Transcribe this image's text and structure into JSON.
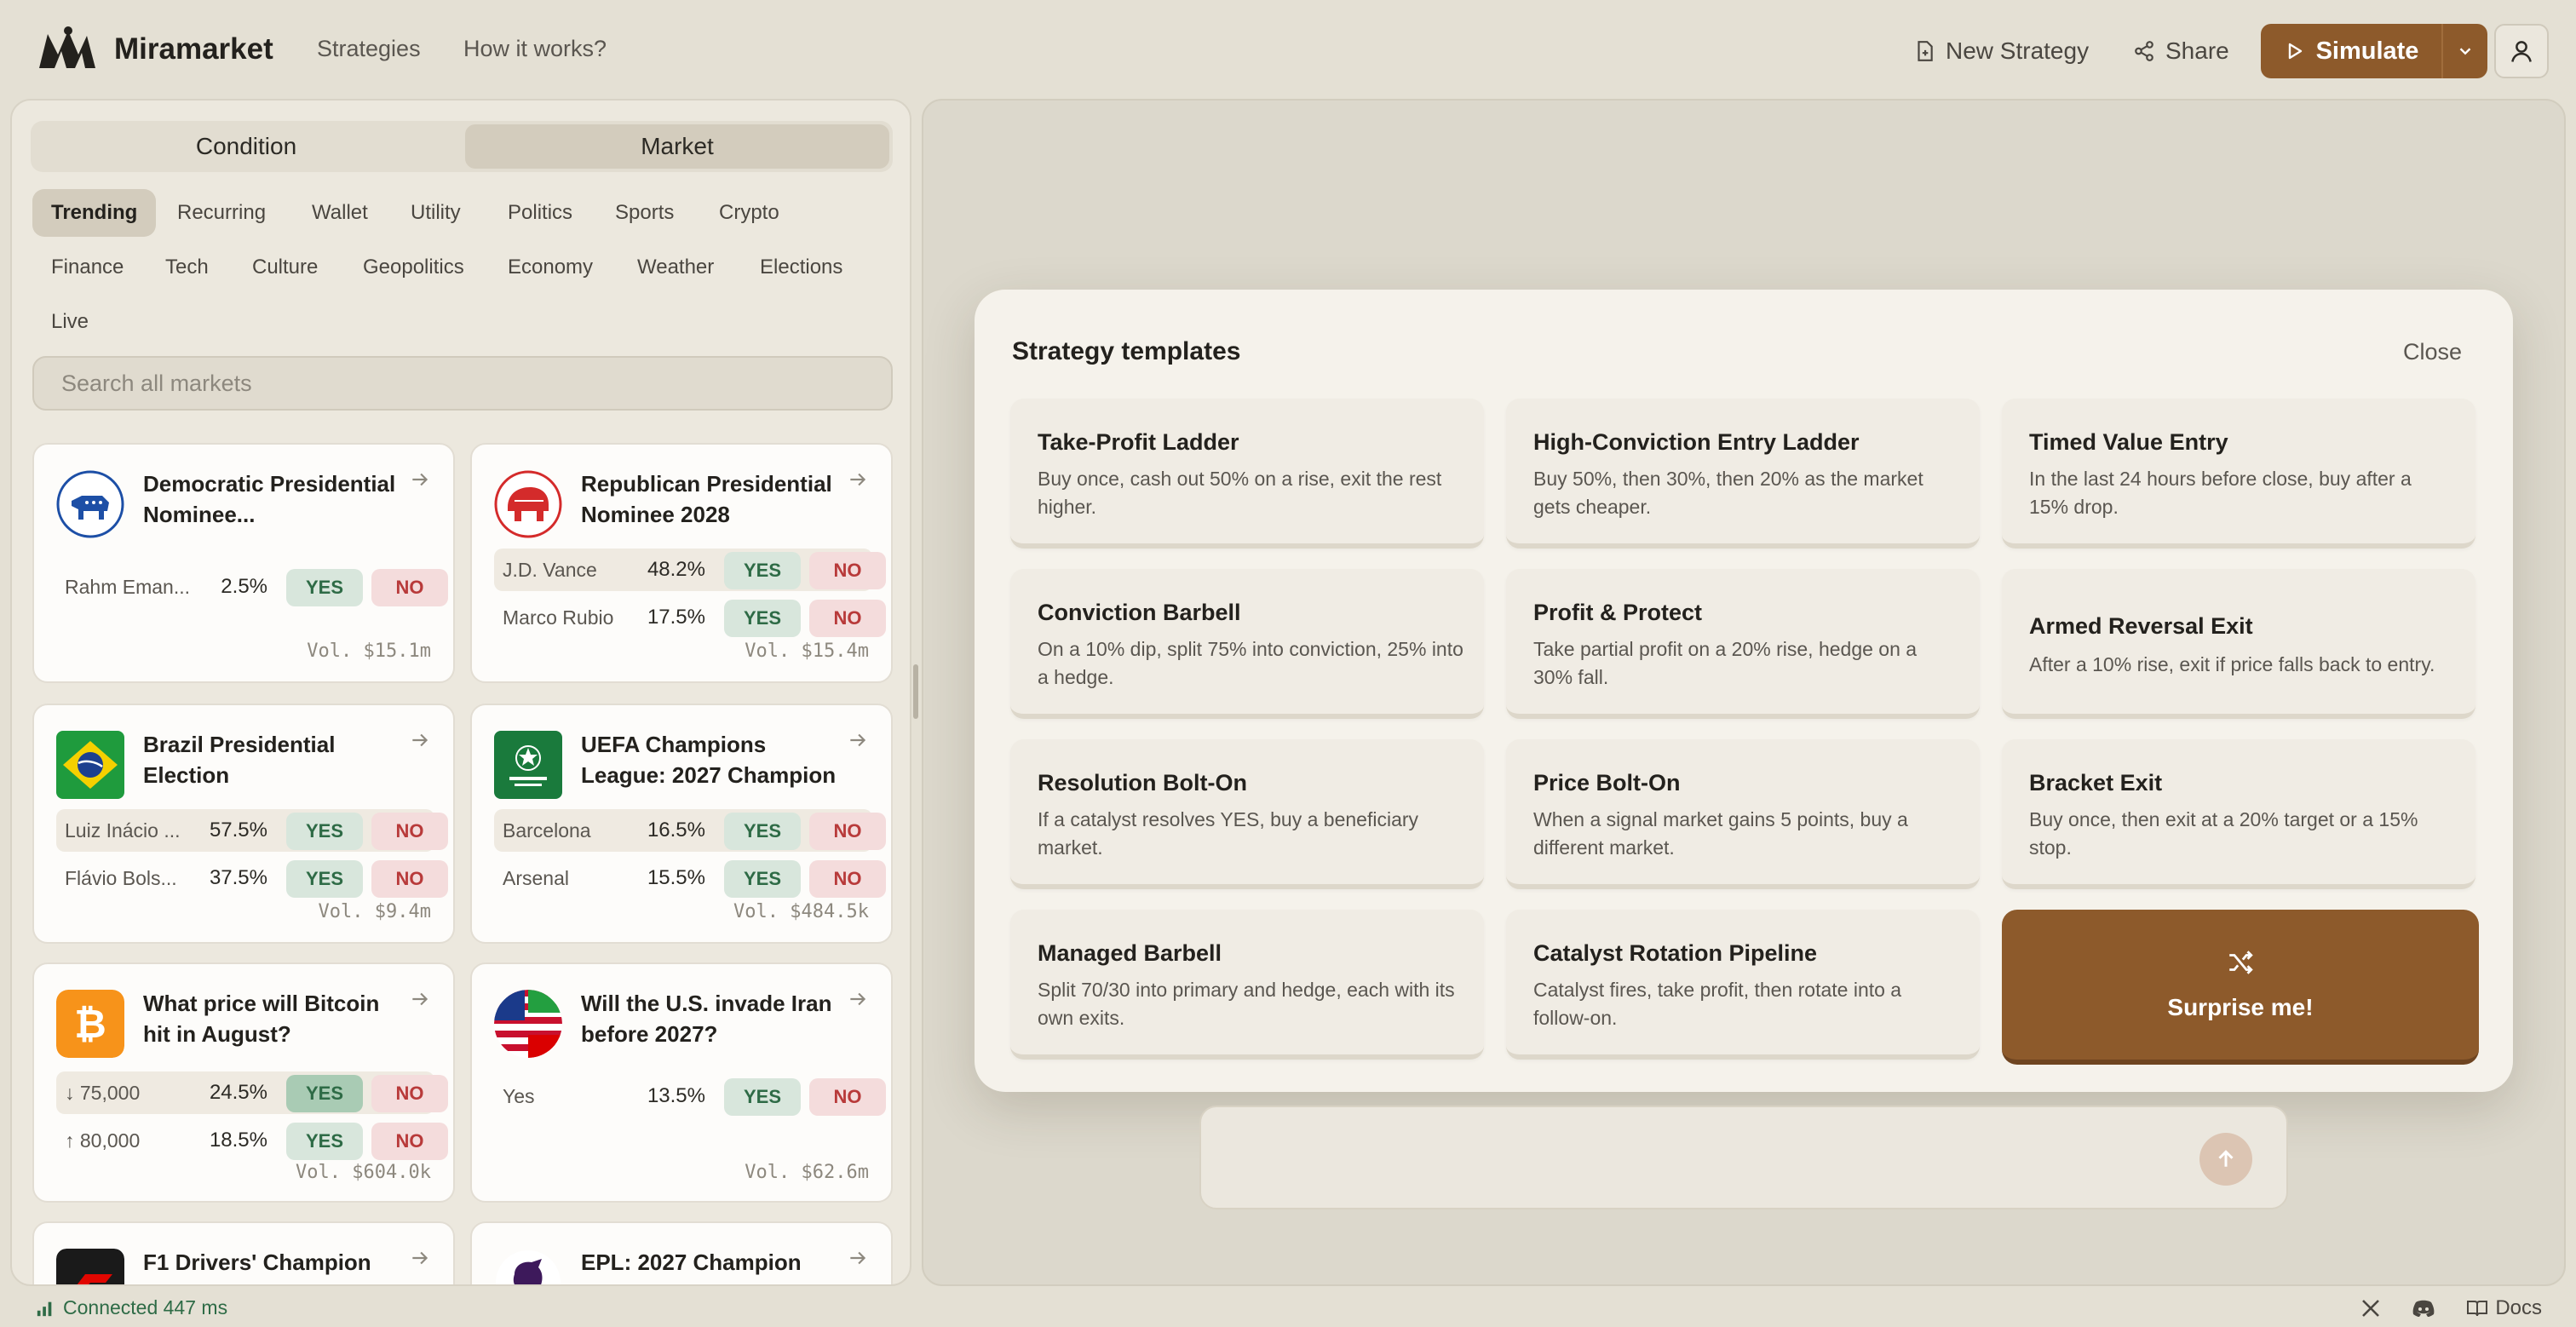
{
  "header": {
    "brand": "Miramarket",
    "nav": [
      "Strategies",
      "How it works?"
    ],
    "new_strategy": "New Strategy",
    "share": "Share",
    "simulate": "Simulate"
  },
  "left": {
    "tabs": [
      "Condition",
      "Market"
    ],
    "active_tab": "Market",
    "chips": [
      "Trending",
      "Recurring",
      "Wallet",
      "Utility",
      "Politics",
      "Sports",
      "Crypto",
      "Finance",
      "Tech",
      "Culture",
      "Geopolitics",
      "Economy",
      "Weather",
      "Elections",
      "Live"
    ],
    "active_chip": "Trending",
    "search_placeholder": "Search all markets",
    "markets": [
      {
        "title": "Democratic Presidential Nominee...",
        "icon": "democrat-icon",
        "outcomes": [
          {
            "label": "Rahm Eman...",
            "pct": "2.5%"
          }
        ],
        "yes": "YES",
        "no": "NO",
        "volume": "Vol. $15.1m"
      },
      {
        "title": "Republican Presidential Nominee 2028",
        "icon": "republican-icon",
        "outcomes": [
          {
            "label": "J.D. Vance",
            "pct": "48.2%"
          },
          {
            "label": "Marco Rubio",
            "pct": "17.5%"
          }
        ],
        "yes": "YES",
        "no": "NO",
        "volume": "Vol. $15.4m"
      },
      {
        "title": "Brazil Presidential Election",
        "icon": "brazil-flag-icon",
        "outcomes": [
          {
            "label": "Luiz Inácio ...",
            "pct": "57.5%"
          },
          {
            "label": "Flávio Bols...",
            "pct": "37.5%"
          }
        ],
        "yes": "YES",
        "no": "NO",
        "volume": "Vol. $9.4m"
      },
      {
        "title": "UEFA Champions League: 2027 Champion",
        "icon": "champions-league-icon",
        "outcomes": [
          {
            "label": "Barcelona",
            "pct": "16.5%"
          },
          {
            "label": "Arsenal",
            "pct": "15.5%"
          }
        ],
        "yes": "YES",
        "no": "NO",
        "volume": "Vol. $484.5k"
      },
      {
        "title": "What price will Bitcoin hit in August?",
        "icon": "bitcoin-icon",
        "outcomes": [
          {
            "label": "↓ 75,000",
            "pct": "24.5%"
          },
          {
            "label": "↑ 80,000",
            "pct": "18.5%"
          }
        ],
        "yes": "YES",
        "no": "NO",
        "volume": "Vol. $604.0k"
      },
      {
        "title": "Will the U.S. invade Iran before 2027?",
        "icon": "us-iran-flag-icon",
        "outcomes": [
          {
            "label": "Yes",
            "pct": "13.5%"
          }
        ],
        "yes": "YES",
        "no": "NO",
        "volume": "Vol. $62.6m"
      },
      {
        "title": "F1 Drivers' Champion",
        "icon": "f1-icon"
      },
      {
        "title": "EPL: 2027 Champion",
        "icon": "premier-league-icon"
      }
    ]
  },
  "modal": {
    "title": "Strategy templates",
    "close": "Close",
    "templates": [
      {
        "name": "Take-Profit Ladder",
        "desc": "Buy once, cash out 50% on a rise, exit the rest higher."
      },
      {
        "name": "High-Conviction Entry Ladder",
        "desc": "Buy 50%, then 30%, then 20% as the market gets cheaper."
      },
      {
        "name": "Timed Value Entry",
        "desc": "In the last 24 hours before close, buy after a 15% drop."
      },
      {
        "name": "Conviction Barbell",
        "desc": "On a 10% dip, split 75% into conviction, 25% into a hedge."
      },
      {
        "name": "Profit & Protect",
        "desc": "Take partial profit on a 20% rise, hedge on a 30% fall."
      },
      {
        "name": "Armed Reversal Exit",
        "desc": "After a 10% rise, exit if price falls back to entry."
      },
      {
        "name": "Resolution Bolt-On",
        "desc": "If a catalyst resolves YES, buy a beneficiary market."
      },
      {
        "name": "Price Bolt-On",
        "desc": "When a signal market gains 5 points, buy a different market."
      },
      {
        "name": "Bracket Exit",
        "desc": "Buy once, then exit at a 20% target or a 15% stop."
      },
      {
        "name": "Managed Barbell",
        "desc": "Split 70/30 into primary and hedge, each with its own exits."
      },
      {
        "name": "Catalyst Rotation Pipeline",
        "desc": "Catalyst fires, take profit, then rotate into a follow-on."
      }
    ],
    "surprise": "Surprise me!"
  },
  "status": {
    "connection": "Connected 447 ms",
    "docs": "Docs"
  },
  "colors": {
    "accent": "#8d5a2b",
    "yes_bg": "#d8e6dc",
    "no_bg": "#f4dcdc",
    "connected": "#2e6b46"
  }
}
